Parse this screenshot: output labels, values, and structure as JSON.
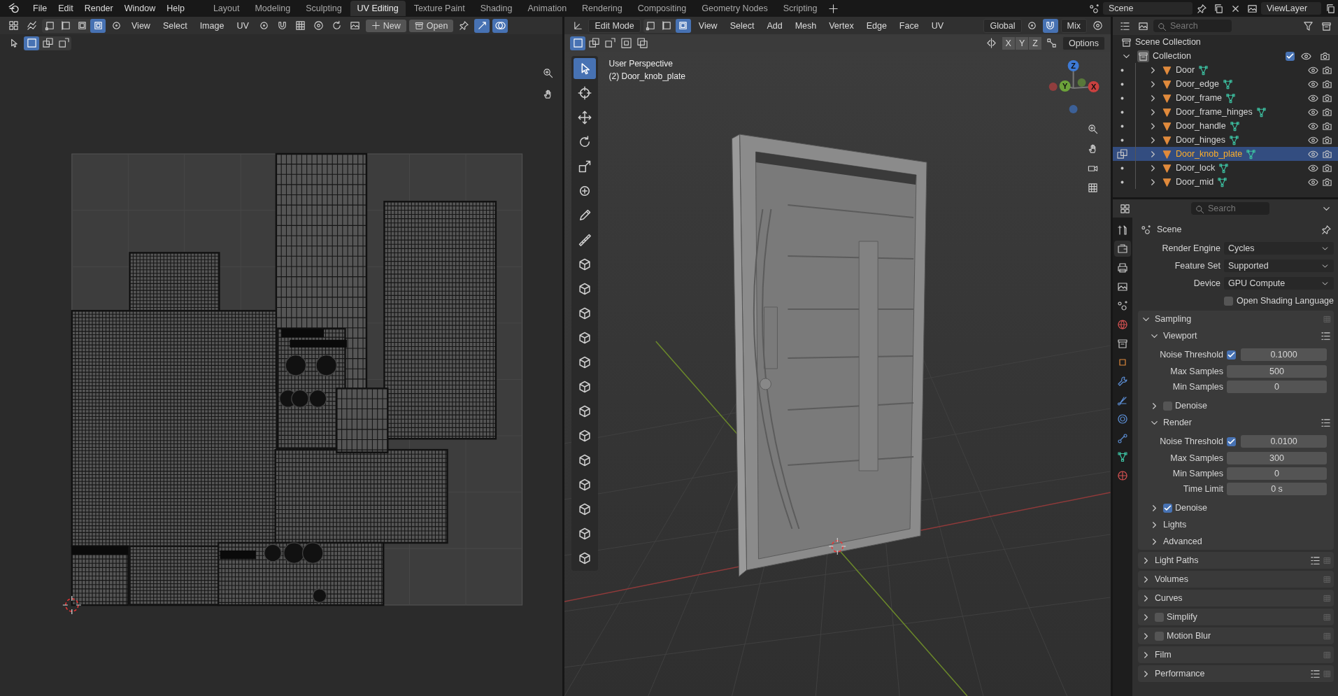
{
  "topbar": {
    "menus": [
      "File",
      "Edit",
      "Render",
      "Window",
      "Help"
    ],
    "workspaces": [
      {
        "label": "Layout",
        "selected": false
      },
      {
        "label": "Modeling",
        "selected": false
      },
      {
        "label": "Sculpting",
        "selected": false
      },
      {
        "label": "UV Editing",
        "selected": true
      },
      {
        "label": "Texture Paint",
        "selected": false
      },
      {
        "label": "Shading",
        "selected": false
      },
      {
        "label": "Animation",
        "selected": false
      },
      {
        "label": "Rendering",
        "selected": false
      },
      {
        "label": "Compositing",
        "selected": false
      },
      {
        "label": "Geometry Nodes",
        "selected": false
      },
      {
        "label": "Scripting",
        "selected": false
      }
    ],
    "scene": "Scene",
    "view_layer": "ViewLayer"
  },
  "uv_editor": {
    "menus": [
      "View",
      "Select",
      "Image",
      "UV"
    ],
    "new_label": "New",
    "open_label": "Open",
    "select_modes": [
      {
        "selected": false
      },
      {
        "selected": false
      },
      {
        "selected": false
      },
      {
        "selected": true
      }
    ],
    "box_modes": [
      {
        "selected": true
      },
      {
        "selected": false
      },
      {
        "selected": false
      }
    ]
  },
  "viewport": {
    "mode": "Edit Mode",
    "select_modes": [
      {
        "selected": false
      },
      {
        "selected": false
      },
      {
        "selected": true
      }
    ],
    "menus": [
      "View",
      "Select",
      "Add",
      "Mesh",
      "Vertex",
      "Edge",
      "Face",
      "UV"
    ],
    "orientation": "Global",
    "snap": true,
    "proportional": "Mix",
    "box_modes": [
      {
        "selected": true
      },
      {
        "selected": false
      },
      {
        "selected": false
      },
      {
        "selected": false
      },
      {
        "selected": false
      }
    ],
    "axes": [
      {
        "label": "X",
        "selected": false
      },
      {
        "label": "Y",
        "selected": false
      },
      {
        "label": "Z",
        "selected": false
      }
    ],
    "options": "Options",
    "overlay_title": "User Perspective",
    "overlay_object": "(2) Door_knob_plate",
    "gizmo": [
      "Z",
      "Y",
      "X"
    ],
    "tools": [
      {
        "kind": "select",
        "selected": true
      },
      {
        "kind": "cursor",
        "selected": false
      },
      {
        "kind": "move",
        "selected": false
      },
      {
        "kind": "rotate",
        "selected": false
      },
      {
        "kind": "scale",
        "selected": false
      },
      {
        "kind": "transform",
        "selected": false
      },
      {
        "kind": "annotate",
        "selected": false
      },
      {
        "kind": "measure",
        "selected": false
      },
      {
        "kind": "add_cube",
        "selected": false
      },
      {
        "kind": "extrude",
        "selected": false
      },
      {
        "kind": "inset",
        "selected": false
      },
      {
        "kind": "bevel",
        "selected": false
      },
      {
        "kind": "loop_cut",
        "selected": false
      },
      {
        "kind": "knife",
        "selected": false
      },
      {
        "kind": "poly_build",
        "selected": false
      },
      {
        "kind": "spin",
        "selected": false
      },
      {
        "kind": "smooth",
        "selected": false
      },
      {
        "kind": "edge_slide",
        "selected": false
      },
      {
        "kind": "shrink",
        "selected": false
      },
      {
        "kind": "shear",
        "selected": false
      },
      {
        "kind": "rip",
        "selected": false
      }
    ]
  },
  "outliner": {
    "search_placeholder": "Search",
    "scene_collection": "Scene Collection",
    "collection": {
      "name": "Collection",
      "expanded": true,
      "checked": true
    },
    "objects": [
      {
        "name": "Door",
        "selected": false
      },
      {
        "name": "Door_edge",
        "selected": false
      },
      {
        "name": "Door_frame",
        "selected": false
      },
      {
        "name": "Door_frame_hinges",
        "selected": false
      },
      {
        "name": "Door_handle",
        "selected": false
      },
      {
        "name": "Door_hinges",
        "selected": false
      },
      {
        "name": "Door_knob_plate",
        "selected": true
      },
      {
        "name": "Door_lock",
        "selected": false
      },
      {
        "name": "Door_mid",
        "selected": false
      }
    ]
  },
  "properties": {
    "search_placeholder": "Search",
    "context": "Scene",
    "tabs": [
      {
        "kind": "tool",
        "selected": false
      },
      {
        "kind": "render",
        "selected": true
      },
      {
        "kind": "output",
        "selected": false
      },
      {
        "kind": "view_layer",
        "selected": false
      },
      {
        "kind": "scene",
        "selected": false
      },
      {
        "kind": "world",
        "selected": false
      },
      {
        "kind": "collection",
        "selected": false
      },
      {
        "kind": "object",
        "selected": false
      },
      {
        "kind": "modifiers",
        "selected": false
      },
      {
        "kind": "particles",
        "selected": false
      },
      {
        "kind": "physics",
        "selected": false
      },
      {
        "kind": "constraints",
        "selected": false
      },
      {
        "kind": "data",
        "selected": false
      },
      {
        "kind": "material",
        "selected": false
      }
    ],
    "fields": [
      {
        "label": "Render Engine",
        "value": "Cycles"
      },
      {
        "label": "Feature Set",
        "value": "Supported"
      },
      {
        "label": "Device",
        "value": "GPU Compute"
      }
    ],
    "osl": {
      "label": "Open Shading Language",
      "checked": false
    },
    "sampling": {
      "label": "Sampling",
      "expanded": true,
      "subpanels": [
        {
          "label": "Viewport",
          "expanded": true,
          "presets": true,
          "rows": [
            {
              "kind": "threshold",
              "label": "Noise Threshold",
              "checked": true,
              "value": "0.1000"
            },
            {
              "kind": "number",
              "label": "Max Samples",
              "value": "500"
            },
            {
              "kind": "number",
              "label": "Min Samples",
              "value": "0"
            }
          ]
        },
        {
          "label": "Denoise",
          "expanded": false,
          "checked": false
        },
        {
          "label": "Render",
          "expanded": true,
          "presets": true,
          "rows": [
            {
              "kind": "threshold",
              "label": "Noise Threshold",
              "checked": true,
              "value": "0.0100"
            },
            {
              "kind": "number",
              "label": "Max Samples",
              "value": "300"
            },
            {
              "kind": "number",
              "label": "Min Samples",
              "value": "0"
            },
            {
              "kind": "number",
              "label": "Time Limit",
              "value": "0 s"
            }
          ]
        },
        {
          "label": "Denoise",
          "expanded": false,
          "checked": true
        },
        {
          "label": "Lights",
          "expanded": false
        },
        {
          "label": "Advanced",
          "expanded": false
        }
      ]
    },
    "panels": [
      {
        "label": "Light Paths",
        "expanded": false,
        "presets": true
      },
      {
        "label": "Volumes",
        "expanded": false
      },
      {
        "label": "Curves",
        "expanded": false
      },
      {
        "label": "Simplify",
        "expanded": false,
        "checked": false
      },
      {
        "label": "Motion Blur",
        "expanded": false,
        "checked": false
      },
      {
        "label": "Film",
        "expanded": false
      },
      {
        "label": "Performance",
        "expanded": false,
        "presets": true
      }
    ]
  }
}
